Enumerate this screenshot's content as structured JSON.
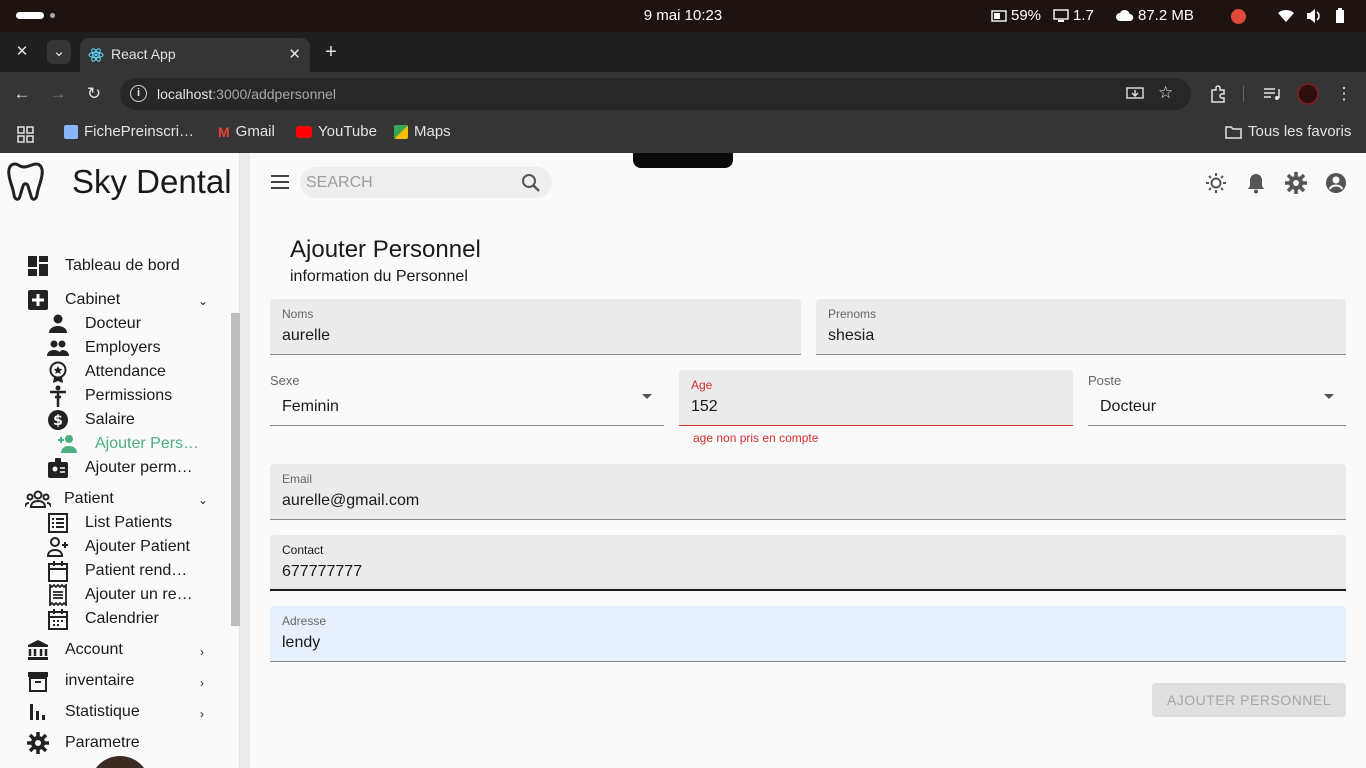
{
  "os": {
    "date_time": "9 mai  10:23",
    "battery": "59%",
    "cpu": "1.7",
    "memory": "87.2 MB"
  },
  "browser": {
    "tab_title": "React App",
    "url_host": "localhost",
    "url_path": ":3000/addpersonnel",
    "bookmarks": [
      "FichePreinscri…",
      "Gmail",
      "YouTube",
      "Maps"
    ],
    "all_bookmarks": "Tous les favoris"
  },
  "app": {
    "brand": "Sky Dental",
    "search_placeholder": "SEARCH"
  },
  "sidebar": {
    "dashboard": "Tableau de bord",
    "cabinet": "Cabinet",
    "cabinet_items": [
      "Docteur",
      "Employers",
      "Attendance",
      "Permissions",
      "Salaire",
      "Ajouter Pers…",
      "Ajouter perm…"
    ],
    "patient": "Patient",
    "patient_items": [
      "List Patients",
      "Ajouter Patient",
      "Patient rend…",
      "Ajouter un re…",
      "Calendrier"
    ],
    "account": "Account",
    "inventaire": "inventaire",
    "statistique": "Statistique",
    "parametre": "Parametre"
  },
  "form": {
    "title": "Ajouter Personnel",
    "subtitle": "information du Personnel",
    "noms_label": "Noms",
    "noms_value": "aurelle",
    "prenoms_label": "Prenoms",
    "prenoms_value": "shesia",
    "sexe_label": "Sexe",
    "sexe_value": "Feminin",
    "age_label": "Age",
    "age_value": "152",
    "age_error": "age non pris en compte",
    "poste_label": "Poste",
    "poste_value": "Docteur",
    "email_label": "Email",
    "email_value": "aurelle@gmail.com",
    "contact_label": "Contact",
    "contact_value": "677777777",
    "adresse_label": "Adresse",
    "adresse_value": "lendy",
    "submit": "AJOUTER PERSONNEL"
  },
  "colors": {
    "accent_green": "#4caf7f",
    "error": "#d32f2f"
  }
}
